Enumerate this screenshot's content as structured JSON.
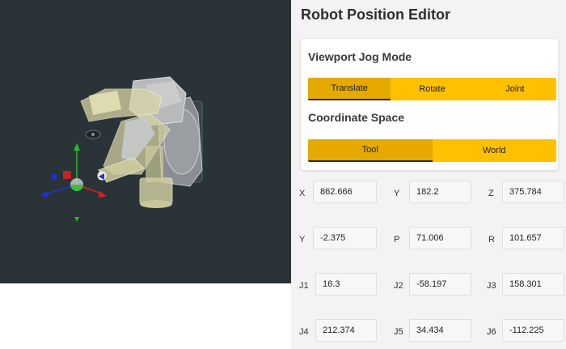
{
  "header": {
    "title": "Robot Position Editor"
  },
  "jog": {
    "heading": "Viewport Jog Mode",
    "options": [
      {
        "label": "Translate",
        "active": true
      },
      {
        "label": "Rotate",
        "active": false
      },
      {
        "label": "Joint",
        "active": false
      }
    ]
  },
  "coord": {
    "heading": "Coordinate Space",
    "options": [
      {
        "label": "Tool",
        "active": true
      },
      {
        "label": "World",
        "active": false
      }
    ]
  },
  "fields": {
    "row1": [
      {
        "label": "X",
        "value": "862.666"
      },
      {
        "label": "Y",
        "value": "182.2"
      },
      {
        "label": "Z",
        "value": "375.784"
      }
    ],
    "row2": [
      {
        "label": "Y",
        "value": "-2.375"
      },
      {
        "label": "P",
        "value": "71.006"
      },
      {
        "label": "R",
        "value": "101.657"
      }
    ],
    "row3": [
      {
        "label": "J1",
        "value": "16.3"
      },
      {
        "label": "J2",
        "value": "-58.197"
      },
      {
        "label": "J3",
        "value": "158.301"
      }
    ],
    "row4": [
      {
        "label": "J4",
        "value": "212.374"
      },
      {
        "label": "J5",
        "value": "34.434"
      },
      {
        "label": "J6",
        "value": "-112.225"
      }
    ]
  },
  "colors": {
    "viewport_bg": "#2a3338",
    "segment_bg": "#ffc000",
    "segment_active": "#e5a900",
    "axis_x": "#e02020",
    "axis_y": "#20c020",
    "axis_z": "#2030e0"
  },
  "icons": {
    "gizmo": "translate-gizmo-icon"
  }
}
